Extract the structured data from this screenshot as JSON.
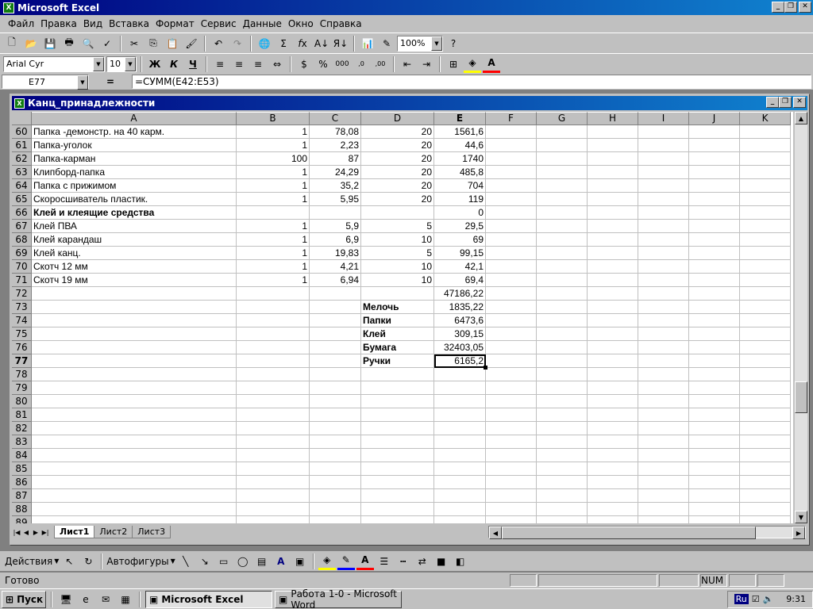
{
  "app": {
    "title": "Microsoft Excel"
  },
  "menu": [
    "Файл",
    "Правка",
    "Вид",
    "Вставка",
    "Формат",
    "Сервис",
    "Данные",
    "Окно",
    "Справка"
  ],
  "toolbar": {
    "zoom": "100%",
    "font_name": "Arial Cyr",
    "font_size": "10"
  },
  "formula_bar": {
    "cell_ref": "E77",
    "eq": "=",
    "formula": "=СУММ(E42:E53)"
  },
  "document": {
    "title": "Канц_принадлежности"
  },
  "grid": {
    "columns": [
      "A",
      "B",
      "C",
      "D",
      "E",
      "F",
      "G",
      "H",
      "I",
      "J",
      "K"
    ],
    "active_column": "E",
    "active_row": "77",
    "rows": [
      {
        "n": "60",
        "a": "Папка -демонстр. на 40 карм.",
        "b": "1",
        "c": "78,08",
        "d": "20",
        "e": "1561,6"
      },
      {
        "n": "61",
        "a": "Папка-уголок",
        "b": "1",
        "c": "2,23",
        "d": "20",
        "e": "44,6"
      },
      {
        "n": "62",
        "a": "Папка-карман",
        "b": "100",
        "c": "87",
        "d": "20",
        "e": "1740"
      },
      {
        "n": "63",
        "a": "Клипборд-папка",
        "b": "1",
        "c": "24,29",
        "d": "20",
        "e": "485,8"
      },
      {
        "n": "64",
        "a": "Папка с прижимом",
        "b": "1",
        "c": "35,2",
        "d": "20",
        "e": "704"
      },
      {
        "n": "65",
        "a": "Скоросшиватель пластик.",
        "b": "1",
        "c": "5,95",
        "d": "20",
        "e": "119"
      },
      {
        "n": "66",
        "a": "Клей и клеящие средства",
        "b": "",
        "c": "",
        "d": "",
        "e": "0",
        "bold": true
      },
      {
        "n": "67",
        "a": "Клей ПВА",
        "b": "1",
        "c": "5,9",
        "d": "5",
        "e": "29,5"
      },
      {
        "n": "68",
        "a": "Клей карандаш",
        "b": "1",
        "c": "6,9",
        "d": "10",
        "e": "69"
      },
      {
        "n": "69",
        "a": "Клей канц.",
        "b": "1",
        "c": "19,83",
        "d": "5",
        "e": "99,15"
      },
      {
        "n": "70",
        "a": "Скотч 12 мм",
        "b": "1",
        "c": "4,21",
        "d": "10",
        "e": "42,1"
      },
      {
        "n": "71",
        "a": "Скотч 19 мм",
        "b": "1",
        "c": "6,94",
        "d": "10",
        "e": "69,4"
      },
      {
        "n": "72",
        "a": "",
        "b": "",
        "c": "",
        "d": "",
        "e": "47186,22"
      },
      {
        "n": "73",
        "a": "",
        "b": "",
        "c": "",
        "d": "Мелочь",
        "e": "1835,22"
      },
      {
        "n": "74",
        "a": "",
        "b": "",
        "c": "",
        "d": "Папки",
        "e": "6473,6"
      },
      {
        "n": "75",
        "a": "",
        "b": "",
        "c": "",
        "d": "Клей",
        "e": "309,15"
      },
      {
        "n": "76",
        "a": "",
        "b": "",
        "c": "",
        "d": "Бумага",
        "e": "32403,05"
      },
      {
        "n": "77",
        "a": "",
        "b": "",
        "c": "",
        "d": "Ручки",
        "e": "6165,2"
      },
      {
        "n": "78",
        "a": "",
        "b": "",
        "c": "",
        "d": "",
        "e": ""
      },
      {
        "n": "79",
        "a": "",
        "b": "",
        "c": "",
        "d": "",
        "e": ""
      },
      {
        "n": "80",
        "a": "",
        "b": "",
        "c": "",
        "d": "",
        "e": ""
      },
      {
        "n": "81",
        "a": "",
        "b": "",
        "c": "",
        "d": "",
        "e": ""
      },
      {
        "n": "82",
        "a": "",
        "b": "",
        "c": "",
        "d": "",
        "e": ""
      },
      {
        "n": "83",
        "a": "",
        "b": "",
        "c": "",
        "d": "",
        "e": ""
      },
      {
        "n": "84",
        "a": "",
        "b": "",
        "c": "",
        "d": "",
        "e": ""
      },
      {
        "n": "85",
        "a": "",
        "b": "",
        "c": "",
        "d": "",
        "e": ""
      },
      {
        "n": "86",
        "a": "",
        "b": "",
        "c": "",
        "d": "",
        "e": ""
      },
      {
        "n": "87",
        "a": "",
        "b": "",
        "c": "",
        "d": "",
        "e": ""
      },
      {
        "n": "88",
        "a": "",
        "b": "",
        "c": "",
        "d": "",
        "e": ""
      },
      {
        "n": "89",
        "a": "",
        "b": "",
        "c": "",
        "d": "",
        "e": ""
      }
    ]
  },
  "sheets": [
    "Лист1",
    "Лист2",
    "Лист3"
  ],
  "active_sheet": "Лист1",
  "drawing": {
    "actions": "Действия",
    "autoshapes": "Автофигуры"
  },
  "status": {
    "ready": "Готово",
    "num": "NUM"
  },
  "taskbar": {
    "start": "Пуск",
    "tasks": [
      {
        "label": "Microsoft Excel",
        "active": true
      },
      {
        "label": "Работа 1-0 - Microsoft Word",
        "active": false
      }
    ],
    "lang": "Ru",
    "clock": "9:31"
  }
}
